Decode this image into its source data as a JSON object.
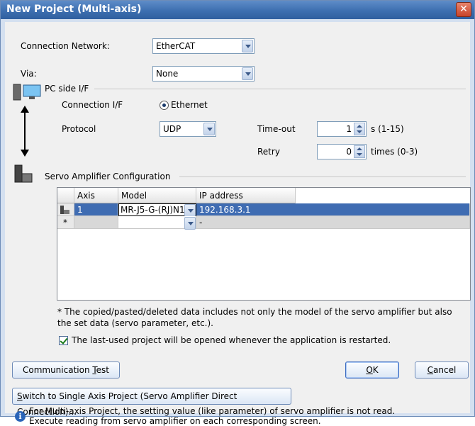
{
  "window": {
    "title": "New Project (Multi-axis)",
    "close": "✕"
  },
  "connection_network": {
    "label": "Connection Network:",
    "value": "EtherCAT"
  },
  "via": {
    "label": "Via:",
    "value": "None"
  },
  "pc_side": {
    "group_label": "PC side I/F",
    "connection_if_label": "Connection I/F",
    "connection_if_value": "Ethernet",
    "protocol_label": "Protocol",
    "protocol_value": "UDP",
    "timeout_label": "Time-out",
    "timeout_value": "1",
    "timeout_unit": "s (1-15)",
    "retry_label": "Retry",
    "retry_value": "0",
    "retry_unit": "times (0-3)"
  },
  "servo_config": {
    "group_label": "Servo Amplifier Configuration",
    "columns": [
      "Axis",
      "Model",
      "IP address"
    ],
    "rows": [
      {
        "marker": "",
        "axis": "1",
        "model": "MR-J5-G-(RJ)N1",
        "ip": "192.168.3.1"
      },
      {
        "marker": "*",
        "axis": "",
        "model": "",
        "ip": "-"
      }
    ]
  },
  "note": "* The copied/pasted/deleted data includes not only the model of the servo amplifier but also the set data (servo parameter, etc.).",
  "last_used_checkbox": {
    "label": "The last-used project will be opened whenever the application is restarted.",
    "checked": true
  },
  "buttons": {
    "comm_test_pre": "Communication ",
    "comm_test_key": "T",
    "comm_test_post": "est",
    "ok_key": "O",
    "ok_post": "K",
    "cancel_key": "C",
    "cancel_post": "ancel",
    "switch_key": "S",
    "switch_post": "witch to Single Axis Project (Servo Amplifier Direct Connection)..."
  },
  "info": {
    "line1": "For Multi-axis Project, the setting value (like parameter) of servo amplifier is not read.",
    "line2": "Execute reading from servo amplifier on each corresponding screen."
  },
  "colors": {
    "title_bar": "#3d6fb0",
    "selected_row": "#3f6cb2"
  }
}
